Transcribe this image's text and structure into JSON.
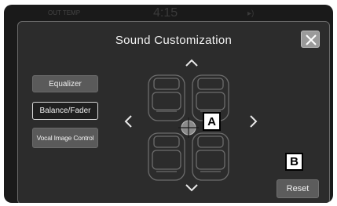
{
  "status_bar": {
    "temp_label": "OUT TEMP",
    "clock": "4:15"
  },
  "dialog": {
    "title": "Sound Customization",
    "side_buttons": {
      "equalizer": "Equalizer",
      "balance_fader": "Balance/Fader",
      "vocal_image_control": "Vocal Image Control"
    },
    "selected_side_button": "Balance/Fader",
    "reset_label": "Reset"
  },
  "callouts": {
    "a": "A",
    "b": "B"
  },
  "colors": {
    "screen_bg": "#1a1a1a",
    "dialog_bg": "#2c2c2c",
    "button_bg": "#5a5a5a",
    "close_button_bg": "#9a9a9a"
  },
  "icons": {
    "close": "close-icon",
    "up": "chevron-up-icon",
    "down": "chevron-down-icon",
    "left": "chevron-left-icon",
    "right": "chevron-right-icon",
    "position": "crosshair-icon"
  }
}
